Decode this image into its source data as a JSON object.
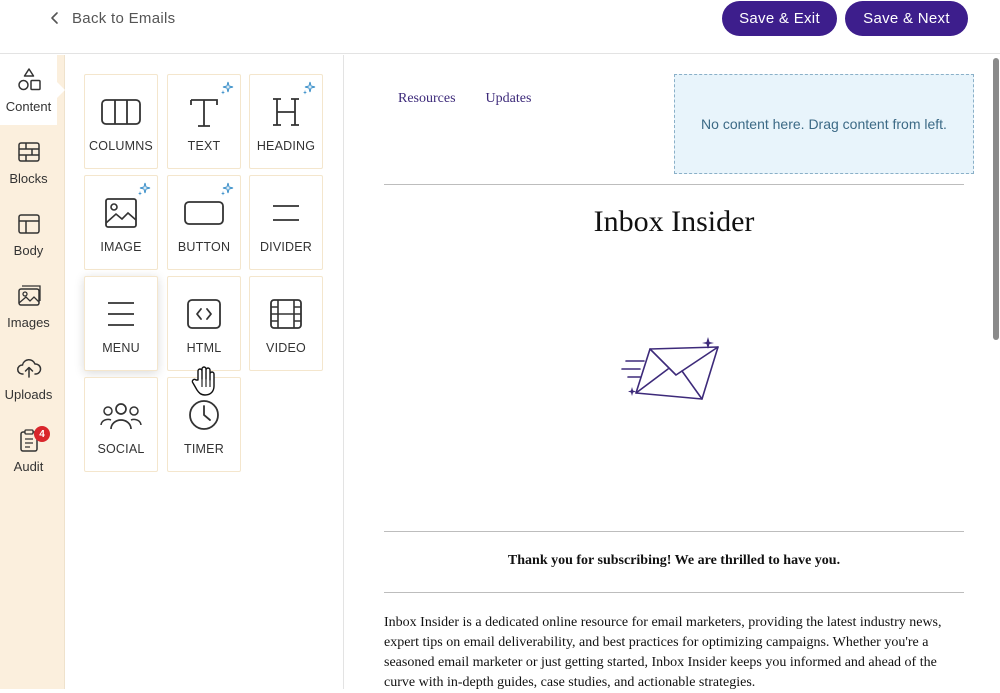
{
  "header": {
    "back_label": "Back to Emails",
    "save_exit_label": "Save & Exit",
    "save_next_label": "Save & Next",
    "accent": "#3d1e8c"
  },
  "rail": {
    "items": [
      {
        "label": "Content",
        "icon": "shapes-icon"
      },
      {
        "label": "Blocks",
        "icon": "brick-wall-icon"
      },
      {
        "label": "Body",
        "icon": "layout-icon"
      },
      {
        "label": "Images",
        "icon": "image-icon"
      },
      {
        "label": "Uploads",
        "icon": "cloud-upload-icon"
      },
      {
        "label": "Audit",
        "icon": "clipboard-icon",
        "badge": "4"
      }
    ]
  },
  "tools": [
    {
      "label": "COLUMNS",
      "icon": "columns-icon",
      "ai": false
    },
    {
      "label": "TEXT",
      "icon": "text-icon",
      "ai": true
    },
    {
      "label": "HEADING",
      "icon": "heading-icon",
      "ai": true
    },
    {
      "label": "IMAGE",
      "icon": "image-icon",
      "ai": true
    },
    {
      "label": "BUTTON",
      "icon": "button-icon",
      "ai": true
    },
    {
      "label": "DIVIDER",
      "icon": "divider-icon",
      "ai": false
    },
    {
      "label": "MENU",
      "icon": "menu-icon",
      "ai": false
    },
    {
      "label": "HTML",
      "icon": "code-icon",
      "ai": false
    },
    {
      "label": "VIDEO",
      "icon": "film-icon",
      "ai": false
    },
    {
      "label": "SOCIAL",
      "icon": "users-icon",
      "ai": false
    },
    {
      "label": "TIMER",
      "icon": "clock-icon",
      "ai": false
    }
  ],
  "email": {
    "menu_links": [
      "Resources",
      "Updates"
    ],
    "drop_zone_text": "No content here. Drag content from left.",
    "title": "Inbox Insider",
    "thanks": "Thank you for subscribing! We are thrilled to have you.",
    "intro": "Inbox Insider is a dedicated online resource for email marketers, providing the latest industry news, expert tips on email deliverability, and best practices for optimizing campaigns. Whether you're a seasoned email marketer or just getting started, Inbox Insider keeps you informed and ahead of the curve with in-depth guides, case studies, and actionable strategies."
  }
}
